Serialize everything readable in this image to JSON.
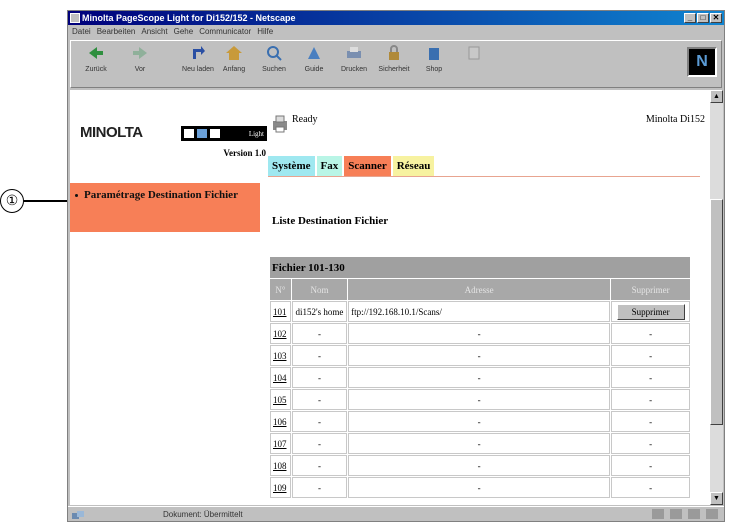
{
  "callout": {
    "number": "①"
  },
  "window": {
    "title": "Minolta PageScope Light for Di152/152 - Netscape",
    "controls": [
      "_",
      "□",
      "✕"
    ]
  },
  "menu": [
    "Datei",
    "Bearbeiten",
    "Ansicht",
    "Gehe",
    "Communicator",
    "Hilfe"
  ],
  "toolbar": {
    "buttons": [
      {
        "label": "Zurück",
        "icon": "back-arrow-icon"
      },
      {
        "label": "Vor",
        "icon": "forward-arrow-icon"
      },
      {
        "label": "Neu laden",
        "icon": "reload-icon"
      },
      {
        "label": "Anfang",
        "icon": "home-icon"
      },
      {
        "label": "Suchen",
        "icon": "search-icon"
      },
      {
        "label": "Guide",
        "icon": "guide-icon"
      },
      {
        "label": "Drucken",
        "icon": "print-icon"
      },
      {
        "label": "Sicherheit",
        "icon": "security-icon"
      },
      {
        "label": "Shop",
        "icon": "shop-icon"
      },
      {
        "label": "",
        "icon": "stop-icon"
      }
    ],
    "logo": "N"
  },
  "sidebar": {
    "brand": "MINOLTA",
    "product_tag": "Light",
    "version": "Version 1.0",
    "nav_item": "Paramétrage Destination Fichier"
  },
  "status": {
    "text": "Ready",
    "model": "Minolta Di152"
  },
  "tabs": [
    {
      "label": "Système"
    },
    {
      "label": "Fax"
    },
    {
      "label": "Scanner"
    },
    {
      "label": "Réseau"
    }
  ],
  "section_title": "Liste Destination Fichier",
  "table": {
    "range_label": "Fichier 101-130",
    "headers": [
      "N°",
      "Nom",
      "Adresse",
      "Supprimer"
    ],
    "rows": [
      {
        "num": "101",
        "name": "di152's home",
        "address": "ftp://192.168.10.1/Scans/",
        "action": "Supprimer"
      },
      {
        "num": "102",
        "name": "-",
        "address": "-",
        "action": "-"
      },
      {
        "num": "103",
        "name": "-",
        "address": "-",
        "action": "-"
      },
      {
        "num": "104",
        "name": "-",
        "address": "-",
        "action": "-"
      },
      {
        "num": "105",
        "name": "-",
        "address": "-",
        "action": "-"
      },
      {
        "num": "106",
        "name": "-",
        "address": "-",
        "action": "-"
      },
      {
        "num": "107",
        "name": "-",
        "address": "-",
        "action": "-"
      },
      {
        "num": "108",
        "name": "-",
        "address": "-",
        "action": "-"
      },
      {
        "num": "109",
        "name": "-",
        "address": "-",
        "action": "-"
      }
    ]
  },
  "statusbar": {
    "text": "Dokument: Übermittelt"
  }
}
